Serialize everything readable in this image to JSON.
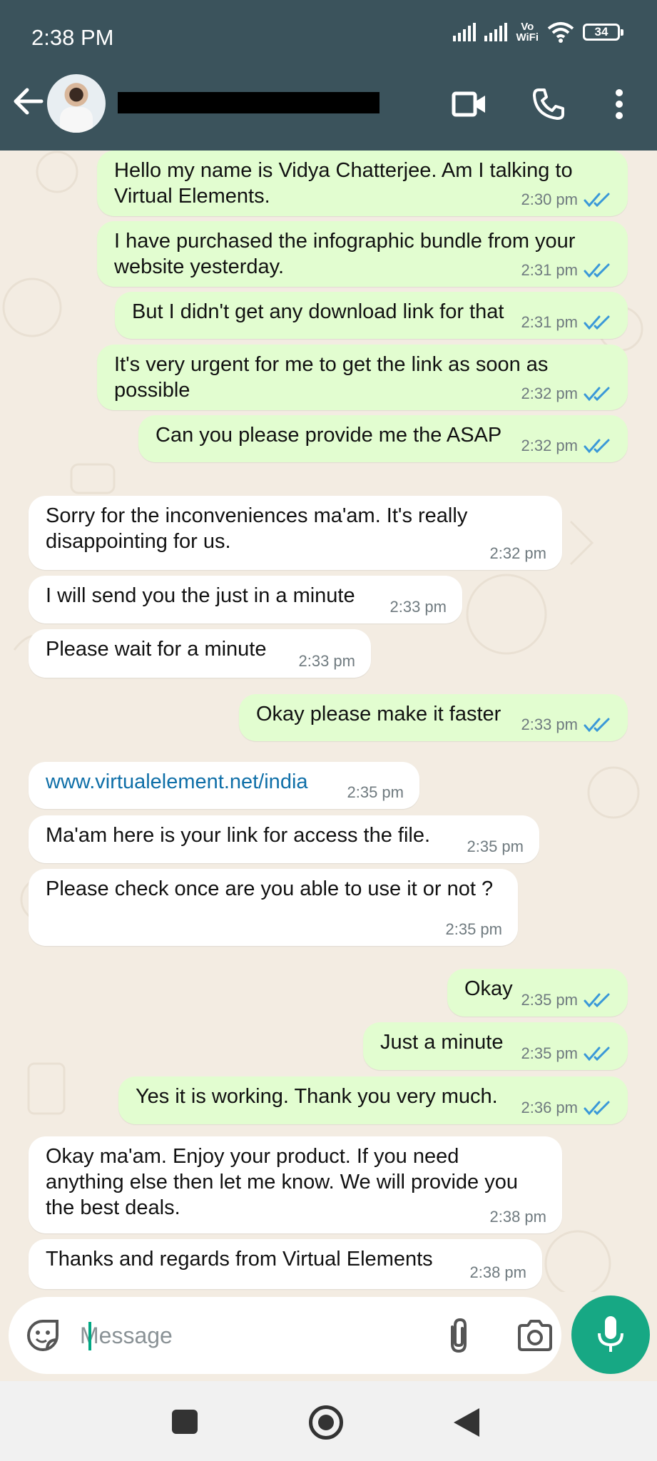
{
  "status_bar": {
    "time": "2:38 PM",
    "vowifi_top": "Vo",
    "vowifi_bottom": "WiFi",
    "battery": "34"
  },
  "header": {
    "back_icon": "arrow-left-icon",
    "avatar": "contact-avatar",
    "name_redacted": true,
    "video_icon": "video-camera-icon",
    "call_icon": "phone-icon",
    "menu_icon": "more-vertical-icon"
  },
  "messages": [
    {
      "dir": "out",
      "text": [
        "Hello my name is Vidya Chatterjee. Am I talking to",
        "Virtual Elements."
      ],
      "time": "2:30 pm",
      "read": true
    },
    {
      "dir": "out",
      "text": [
        "I have purchased the infographic bundle from your",
        "website yesterday."
      ],
      "time": "2:31 pm",
      "read": true
    },
    {
      "dir": "out",
      "text": [
        "But I didn't get any download link for that"
      ],
      "time": "2:31 pm",
      "read": true
    },
    {
      "dir": "out",
      "text": [
        "It's very urgent for me to get the link as soon as",
        "possible"
      ],
      "time": "2:32 pm",
      "read": true
    },
    {
      "dir": "out",
      "text": [
        "Can you please provide me the ASAP"
      ],
      "time": "2:32 pm",
      "read": true
    },
    {
      "dir": "in",
      "text": [
        "Sorry for the inconveniences ma'am. It's really",
        "disappointing for us."
      ],
      "time": "2:32 pm"
    },
    {
      "dir": "in",
      "text": [
        "I will send you the just in a minute"
      ],
      "time": "2:33 pm"
    },
    {
      "dir": "in",
      "text": [
        "Please wait for a minute"
      ],
      "time": "2:33 pm"
    },
    {
      "dir": "out",
      "text": [
        "Okay please make it faster"
      ],
      "time": "2:33 pm",
      "read": true
    },
    {
      "dir": "in",
      "text": [
        "www.virtualelement.net/india"
      ],
      "time": "2:35 pm",
      "link": true
    },
    {
      "dir": "in",
      "text": [
        "Ma'am here is your link for access the file."
      ],
      "time": "2:35 pm"
    },
    {
      "dir": "in",
      "text": [
        "Please check once are you able to use it or not ?"
      ],
      "time": "2:35 pm"
    },
    {
      "dir": "out",
      "text": [
        "Okay"
      ],
      "time": "2:35 pm",
      "read": true
    },
    {
      "dir": "out",
      "text": [
        "Just a minute"
      ],
      "time": "2:35 pm",
      "read": true
    },
    {
      "dir": "out",
      "text": [
        "Yes it is working. Thank you very much."
      ],
      "time": "2:36 pm",
      "read": true
    },
    {
      "dir": "in",
      "text": [
        "Okay ma'am. Enjoy your product. If you need",
        "anything else then let me know. We will provide you",
        "the best deals."
      ],
      "time": "2:38 pm"
    },
    {
      "dir": "in",
      "text": [
        "Thanks and regards from Virtual Elements"
      ],
      "time": "2:38 pm"
    }
  ],
  "composer": {
    "placeholder": "Message",
    "emoji_icon": "sticker-icon",
    "attach_icon": "paperclip-icon",
    "camera_icon": "camera-icon",
    "mic_icon": "microphone-icon"
  },
  "colors": {
    "header": "#3b535c",
    "outgoing_bubble": "#e2fdd0",
    "incoming_bubble": "#ffffff",
    "read_ticks": "#3a98d8",
    "accent": "#17a884",
    "chat_background": "#f3ece2"
  }
}
